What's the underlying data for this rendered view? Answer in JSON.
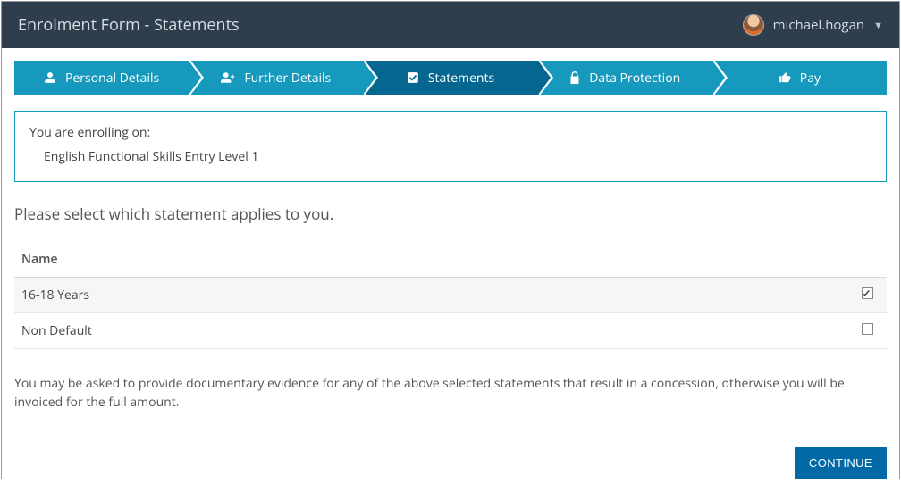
{
  "header": {
    "title": "Enrolment Form - Statements",
    "user": "michael.hogan"
  },
  "steps": [
    {
      "label": "Personal Details",
      "icon": "person"
    },
    {
      "label": "Further Details",
      "icon": "person-plus"
    },
    {
      "label": "Statements",
      "icon": "check-square",
      "active": true
    },
    {
      "label": "Data Protection",
      "icon": "lock"
    },
    {
      "label": "Pay",
      "icon": "thumbs-up"
    }
  ],
  "enrolment": {
    "label": "You are enrolling on:",
    "course": "English Functional Skills Entry Level 1"
  },
  "prompt": "Please select which statement applies to you.",
  "table": {
    "header": "Name",
    "rows": [
      {
        "name": "16-18 Years",
        "checked": true
      },
      {
        "name": "Non Default",
        "checked": false
      }
    ]
  },
  "note": "You may be asked to provide documentary evidence for any of the above selected statements that result in a concession, otherwise you will be invoiced for the full amount.",
  "actions": {
    "continue": "CONTINUE"
  }
}
